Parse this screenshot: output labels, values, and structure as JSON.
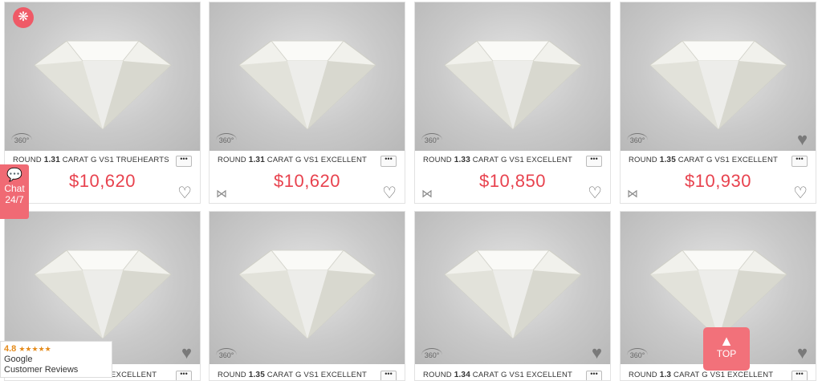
{
  "logo": {
    "icon": "gem-icon",
    "glyph": "❋"
  },
  "chat": {
    "label_line1": "Chat",
    "label_line2": "24/7",
    "icon": "chat-bubble-icon"
  },
  "reviews": {
    "rating": "4.8",
    "stars": "★★★★★",
    "source": "Google",
    "label": "Customer Reviews"
  },
  "top_button": {
    "label": "TOP",
    "arrow": "▲"
  },
  "more_label": "•••",
  "badge_360": "360°",
  "heart_glyph": "♡",
  "heart_filled_glyph": "♥",
  "fairy_glyph": "⋈",
  "colors": {
    "price": "#e8424e",
    "accent": "#f06a74"
  },
  "products": [
    {
      "prefix": "ROUND",
      "carat": "1.31",
      "suffix": "CARAT G VS1  TRUEHEARTS",
      "price": "$10,620"
    },
    {
      "prefix": "ROUND",
      "carat": "1.31",
      "suffix": "CARAT G VS1  EXCELLENT",
      "price": "$10,620"
    },
    {
      "prefix": "ROUND",
      "carat": "1.33",
      "suffix": "CARAT G VS1  EXCELLENT",
      "price": "$10,850"
    },
    {
      "prefix": "ROUND",
      "carat": "1.35",
      "suffix": "CARAT G VS1  EXCELLENT",
      "price": "$10,930"
    },
    {
      "prefix": "",
      "carat": "",
      "suffix": "EXCELLENT",
      "price": ""
    },
    {
      "prefix": "ROUND",
      "carat": "1.35",
      "suffix": "CARAT G VS1  EXCELLENT",
      "price": ""
    },
    {
      "prefix": "ROUND",
      "carat": "1.34",
      "suffix": "CARAT G VS1  EXCELLENT",
      "price": ""
    },
    {
      "prefix": "ROUND",
      "carat": "1.3",
      "suffix": "CARAT G VS1  EXCELLENT",
      "price": ""
    }
  ]
}
